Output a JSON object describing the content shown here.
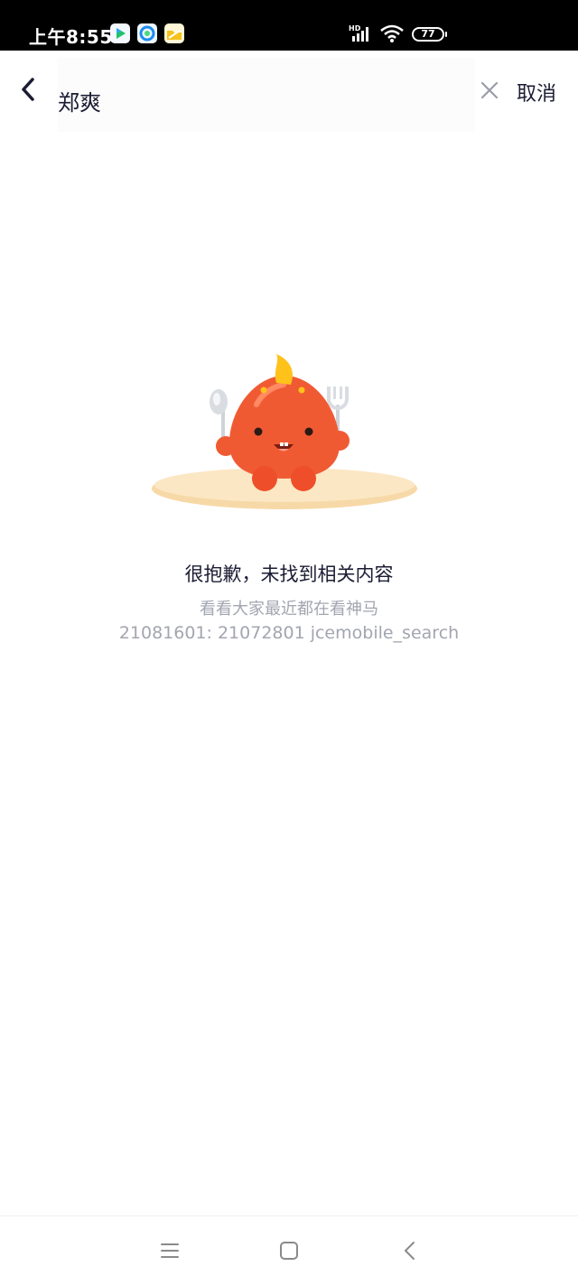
{
  "status_bar": {
    "time": "上午8:55",
    "battery": "77",
    "network": "HD",
    "icons": [
      "video-app-icon",
      "browser-app-icon",
      "files-app-icon",
      "signal-icon",
      "wifi-icon",
      "battery-icon"
    ]
  },
  "header": {
    "search_query": "郑爽",
    "cancel_label": "取消",
    "icons": [
      "back-arrow-icon",
      "clear-x-icon"
    ]
  },
  "empty_state": {
    "title": "很抱歉，未找到相关内容",
    "subtitle": "看看大家最近都在看神马",
    "debug_code": "21081601: 21072801 jcemobile_search"
  },
  "nav_bar": {
    "icons": [
      "menu-icon",
      "home-square-icon",
      "back-chevron-icon"
    ]
  },
  "colors": {
    "accent_text": "#1b1c33",
    "muted_text": "#a3a5b0",
    "mascot": "#f05a33"
  }
}
